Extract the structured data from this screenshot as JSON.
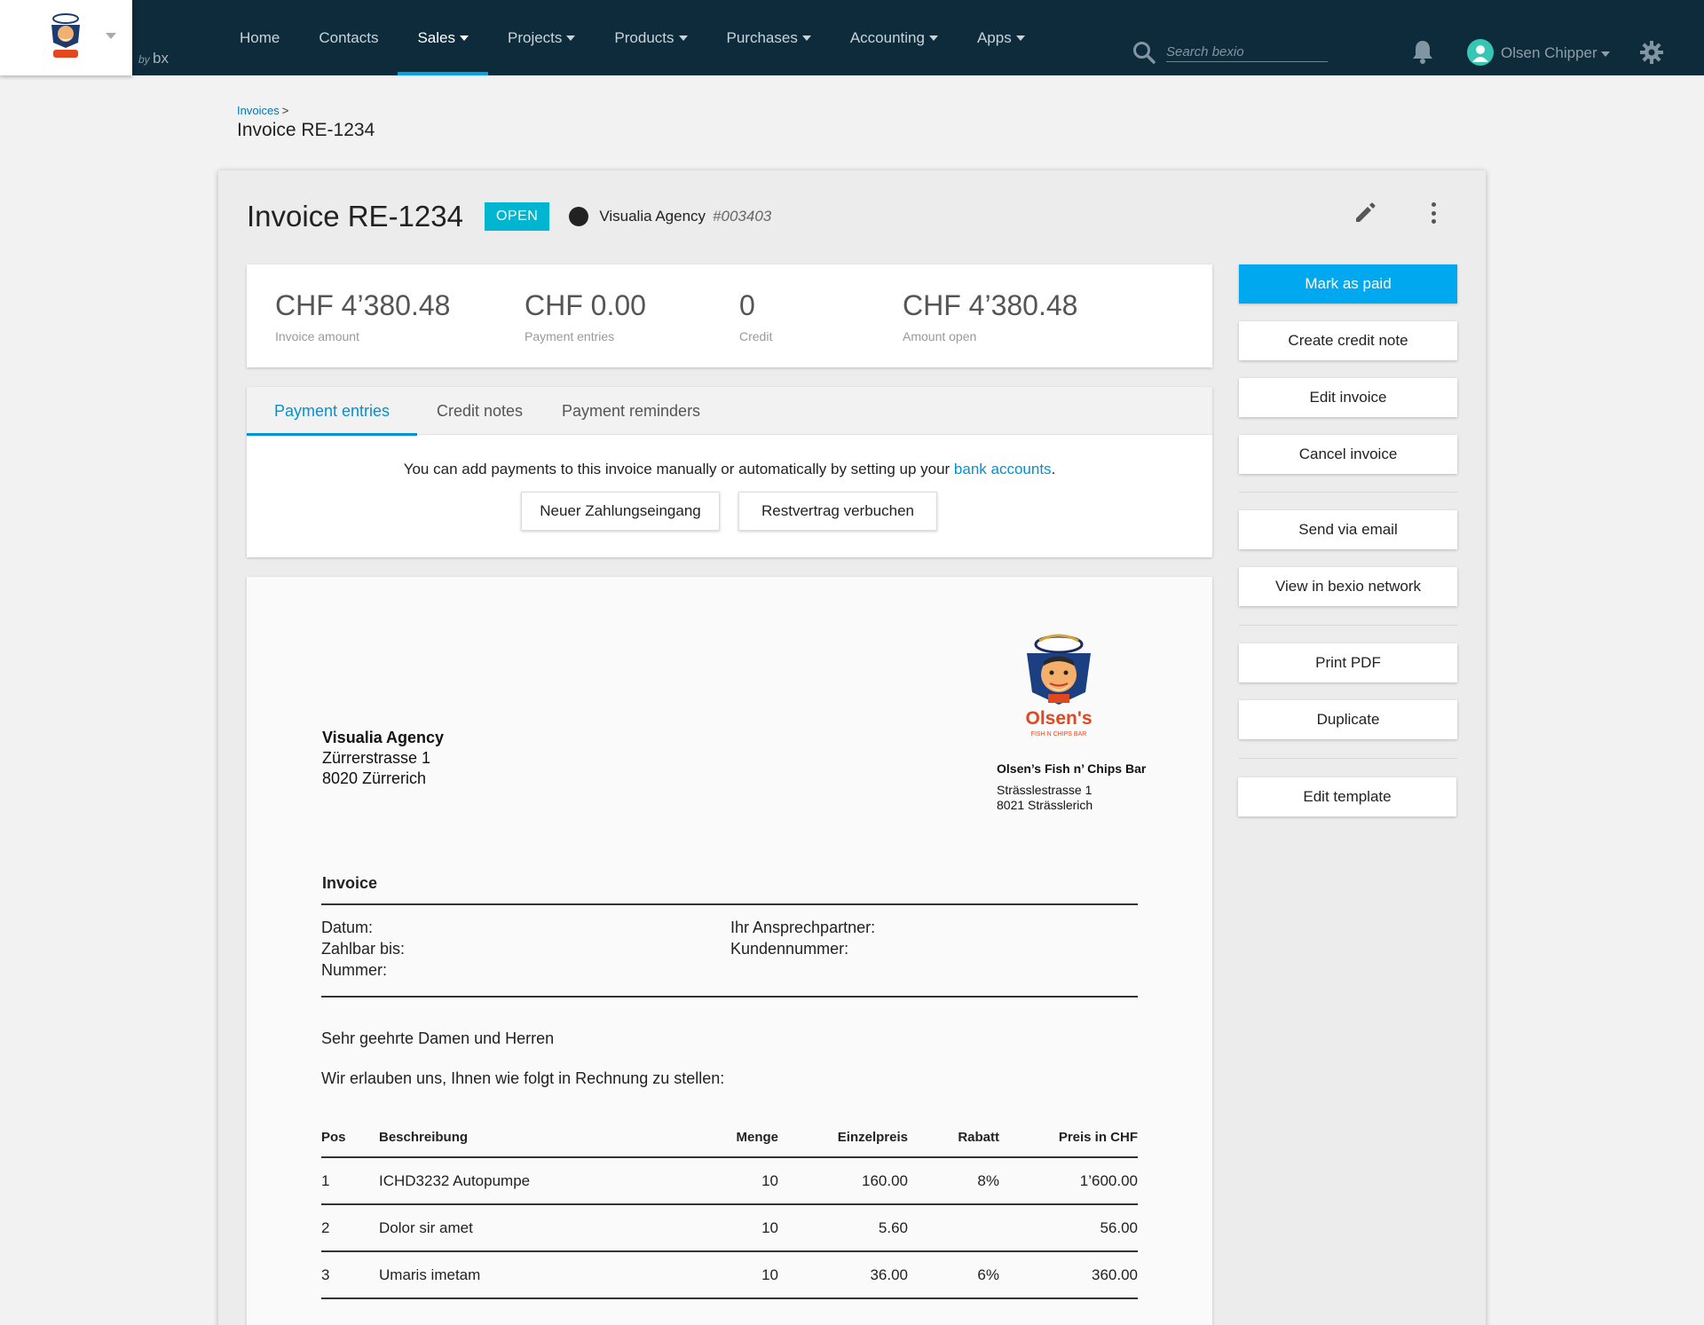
{
  "nav": {
    "brand_by": "by",
    "brand_bx": "bx",
    "items": [
      {
        "label": "Home",
        "dropdown": false
      },
      {
        "label": "Contacts",
        "dropdown": false
      },
      {
        "label": "Sales",
        "dropdown": true,
        "active": true
      },
      {
        "label": "Projects",
        "dropdown": true
      },
      {
        "label": "Products",
        "dropdown": true
      },
      {
        "label": "Purchases",
        "dropdown": true
      },
      {
        "label": "Accounting",
        "dropdown": true
      },
      {
        "label": "Apps",
        "dropdown": true
      }
    ],
    "search_placeholder": "Search bexio",
    "user_name": "Olsen Chipper"
  },
  "breadcrumb": {
    "parent": "Invoices",
    "separator": ">",
    "current": "Invoice RE-1234"
  },
  "invoice": {
    "title": "Invoice RE-1234",
    "status": "OPEN",
    "contact_name": "Visualia Agency",
    "contact_number": "#003403"
  },
  "summary": [
    {
      "value": "CHF 4’380.48",
      "label": "Invoice amount"
    },
    {
      "value": "CHF 0.00",
      "label": "Payment entries"
    },
    {
      "value": "0",
      "label": "Credit"
    },
    {
      "value": "CHF 4’380.48",
      "label": "Amount open"
    }
  ],
  "tabs": [
    {
      "label": "Payment entries",
      "active": true
    },
    {
      "label": "Credit notes"
    },
    {
      "label": "Payment reminders"
    }
  ],
  "payments": {
    "info_prefix": "You can add payments to this invoice manually or automatically by setting up your ",
    "info_link": "bank accounts",
    "info_suffix": ".",
    "new_payment_label": "Neuer Zahlungseingang",
    "book_rest_label": "Restvertrag verbuchen"
  },
  "actions": {
    "mark_paid": "Mark as paid",
    "create_credit": "Create credit note",
    "edit_invoice": "Edit invoice",
    "cancel_invoice": "Cancel invoice",
    "send_email": "Send via email",
    "view_network": "View in bexio network",
    "print_pdf": "Print PDF",
    "duplicate": "Duplicate",
    "edit_template": "Edit template"
  },
  "document": {
    "recipient": {
      "name": "Visualia Agency",
      "street": "Zürrerstrasse 1",
      "city": "8020 Zürrerich"
    },
    "sender": {
      "name": "Olsen’s Fish n’ Chips Bar",
      "street": "Strässlestrasse 1",
      "city": "8021 Strässlerich"
    },
    "logo_text": "Olsen's",
    "logo_sub": "FISH N CHIPS BAR",
    "title": "Invoice",
    "meta_left": [
      "Datum:",
      "Zahlbar bis:",
      "Nummer:"
    ],
    "meta_right": [
      "Ihr Ansprechpartner:",
      "Kundennummer:"
    ],
    "greeting": "Sehr geehrte Damen und Herren",
    "intro": "Wir erlauben uns, Ihnen wie folgt in Rechnung zu stellen:",
    "table": {
      "headers": [
        "Pos",
        "Beschreibung",
        "Menge",
        "Einzelpreis",
        "Rabatt",
        "Preis in CHF"
      ],
      "rows": [
        [
          "1",
          "ICHD3232 Autopumpe",
          "10",
          "160.00",
          "8%",
          "1’600.00"
        ],
        [
          "2",
          "Dolor sir amet",
          "10",
          "5.60",
          "",
          "56.00"
        ],
        [
          "3",
          "Umaris imetam",
          "10",
          "36.00",
          "6%",
          "360.00"
        ]
      ]
    }
  },
  "colors": {
    "topbar": "#0e2b3b",
    "accent": "#00a0e6",
    "badge": "#00b5cf",
    "primary_button": "#00a8f0"
  }
}
